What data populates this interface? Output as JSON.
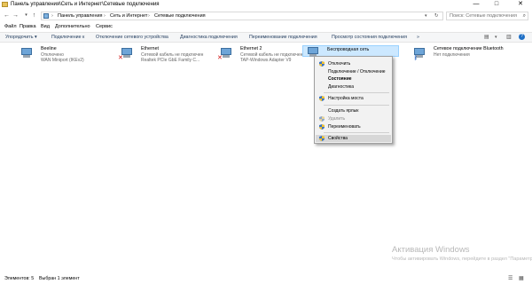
{
  "window": {
    "title": "Панель управления\\Сеть и Интернет\\Сетевые подключения",
    "minimize": "—",
    "maximize": "□",
    "close": "✕"
  },
  "address": {
    "back": "←",
    "forward": "→",
    "up": "↑",
    "crumbs": [
      "Панель управления",
      "Сеть и Интернет",
      "Сетевые подключения"
    ],
    "separator": "›",
    "search_placeholder": "Поиск: Сетевые подключения"
  },
  "menubar": [
    "Файл",
    "Правка",
    "Вид",
    "Дополнительно",
    "Сервис"
  ],
  "commandbar": {
    "items": [
      "Упорядочить ▾",
      "Подключение к",
      "Отключение сетевого устройства",
      "Диагностика подключения",
      "Переименование подключения",
      "Просмотр состояния подключения",
      "»"
    ]
  },
  "adapters": [
    {
      "name": "Beeline",
      "status": "Отключено",
      "device": "WAN Miniport (IKEv2)"
    },
    {
      "name": "Ethernet",
      "status": "Сетевой кабель не подключен",
      "device": "Realtek PCIe GbE Family C..."
    },
    {
      "name": "Ethernet 2",
      "status": "Сетевой кабель не подключен",
      "device": "TAP-Windows Adapter V9"
    },
    {
      "name": "Беспроводная сеть",
      "status": "",
      "device": ""
    },
    {
      "name": "Сетевое подключение Bluetooth",
      "status": "Нет подключения",
      "device": ""
    }
  ],
  "context_menu": {
    "items": [
      "Отключить",
      "Подключение / Отключение",
      "Состояние",
      "Диагностика",
      "Настройка моста",
      "Создать ярлык",
      "Удалить",
      "Переименовать",
      "Свойства"
    ]
  },
  "watermark": {
    "line1": "Активация Windows",
    "line2": "Чтобы активировать Windows, перейдите в раздел \"Параметры\"."
  },
  "statusbar": {
    "items_count": "Элементов: 5",
    "selected": "Выбран 1 элемент"
  },
  "colors": {
    "selection": "#cce8ff",
    "command_text": "#1e395b",
    "error_x": "#d01010"
  }
}
